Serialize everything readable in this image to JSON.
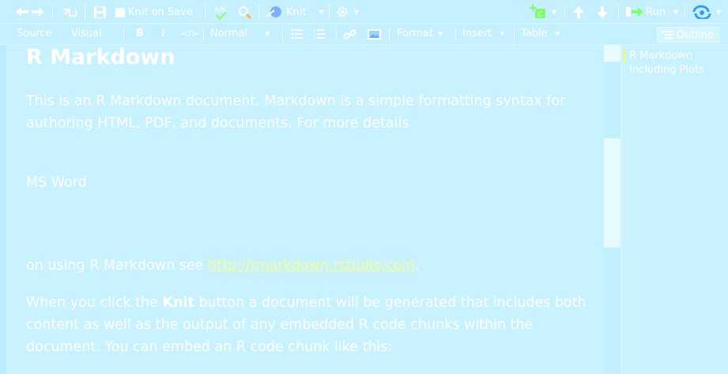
{
  "toolbar_top": {
    "knit_on_save_label": "Knit on Save",
    "knit_label": "Knit",
    "run_label": "Run"
  },
  "toolbar_format": {
    "source_label": "Source",
    "visual_label": "Visual",
    "bold_label": "B",
    "italic_label": "I",
    "code_label": "</>",
    "style_select": "Normal",
    "format_menu": "Format",
    "insert_menu": "Insert",
    "table_menu": "Table",
    "outline_label": "Outline"
  },
  "document": {
    "title": "R Markdown",
    "para1": "This is an R Markdown document. Markdown is a simple formatting syntax for authoring HTML, PDF, and documents. For more details",
    "para2": "MS Word",
    "para3_prefix": " on using R Markdown see ",
    "para3_link": "http://rmarkdown.rstudio.com",
    "para3_suffix": ".",
    "para4_prefix": "When you click the ",
    "para4_bold": "Knit",
    "para4_suffix": " button a document will be generated that includes both content as well as the output of any embedded R code chunks within the document. You can embed an R code chunk like this:"
  },
  "outline": {
    "items": [
      "R Markdown",
      "Including Plots"
    ]
  },
  "colors": {
    "background": "#c8f2ff",
    "link": "#f0ff9a",
    "outline_marker": "#e8ff7a",
    "add_chunk_icon": "#7dff6a",
    "check_icon": "#8cff6a"
  }
}
